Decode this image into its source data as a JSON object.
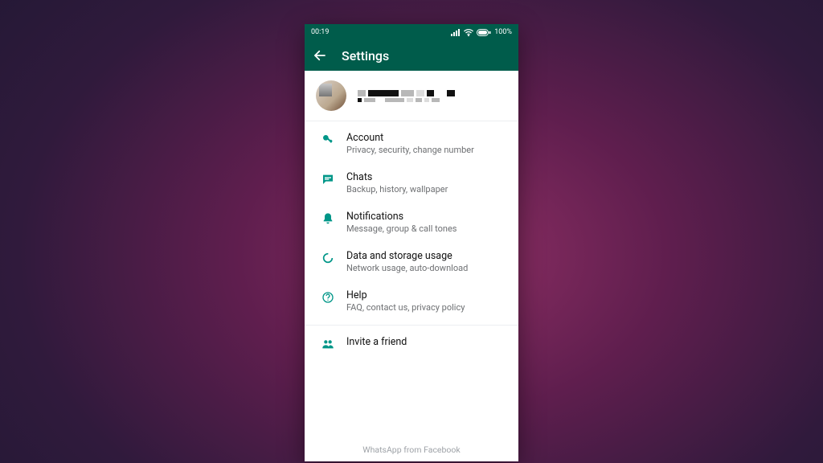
{
  "statusbar": {
    "time": "00:19",
    "battery": "100"
  },
  "appbar": {
    "title": "Settings"
  },
  "menu": {
    "account": {
      "title": "Account",
      "sub": "Privacy, security, change number"
    },
    "chats": {
      "title": "Chats",
      "sub": "Backup, history, wallpaper"
    },
    "notifications": {
      "title": "Notifications",
      "sub": "Message, group & call tones"
    },
    "data": {
      "title": "Data and storage usage",
      "sub": "Network usage, auto-download"
    },
    "help": {
      "title": "Help",
      "sub": "FAQ, contact us, privacy policy"
    },
    "invite": {
      "title": "Invite a friend"
    }
  },
  "footer": {
    "text": "WhatsApp from Facebook"
  }
}
